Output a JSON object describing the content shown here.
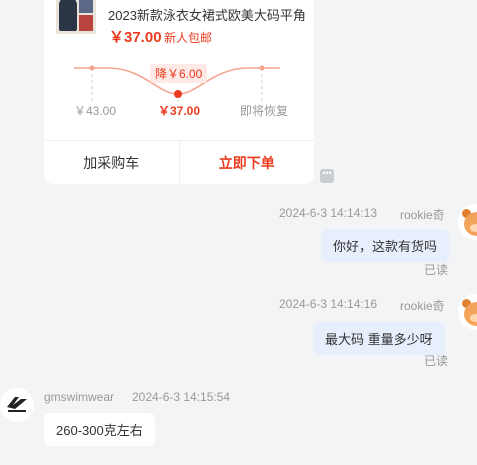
{
  "product_card": {
    "title": "2023新款泳衣女裙式欧美大码平角",
    "price": "￥37.00",
    "tag": "新人包邮",
    "drop_badge": "降￥6.00",
    "original_price": "￥43.00",
    "current_price": "￥37.00",
    "restore_label": "即将恢复",
    "add_cart_label": "加采购车",
    "buy_now_label": "立即下单"
  },
  "more_icon": "more-icon",
  "messages": [
    {
      "side": "right",
      "sender": "rookie奇",
      "time": "2024-6-3 14:14:13",
      "text": "你好，这款有货吗",
      "status": "已读"
    },
    {
      "side": "right",
      "sender": "rookie奇",
      "time": "2024-6-3 14:14:16",
      "text": "最大码  重量多少呀",
      "status": "已读"
    },
    {
      "side": "left",
      "sender": "gmswimwear",
      "time": "2024-6-3 14:15:54",
      "text": "260-300克左右"
    }
  ],
  "colors": {
    "accent": "#ea3b1f",
    "bubble_right": "#e7eefc",
    "background": "#f3f4f6"
  }
}
